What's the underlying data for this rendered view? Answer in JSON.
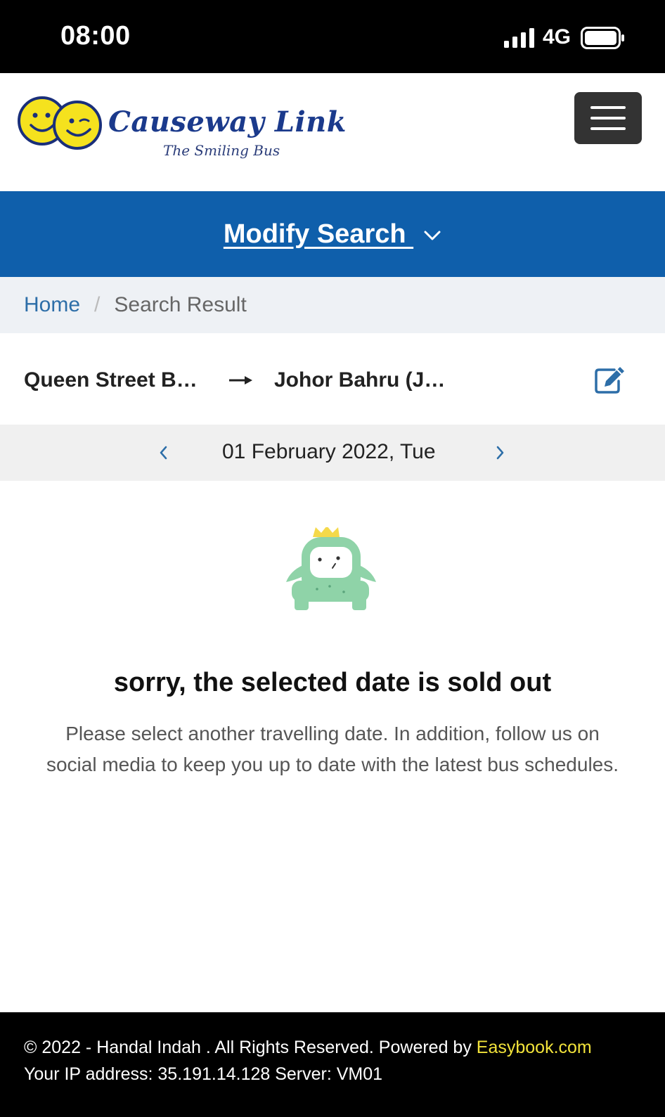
{
  "status_bar": {
    "time": "08:00",
    "network": "4G"
  },
  "header": {
    "brand_name": "Causeway Link",
    "brand_tagline": "The Smiling Bus",
    "menu_icon": "hamburger-icon"
  },
  "modify_search": {
    "label": "Modify Search ",
    "icon": "chevron-down-icon"
  },
  "breadcrumb": {
    "home": "Home",
    "separator": "/",
    "current": "Search Result"
  },
  "route": {
    "from": "Queen Street B…",
    "to": "Johor Bahru (J…",
    "arrow_icon": "arrow-right-icon",
    "edit_icon": "edit-icon"
  },
  "date_nav": {
    "date": "01 February 2022, Tue",
    "prev_icon": "chevron-left-icon",
    "next_icon": "chevron-right-icon"
  },
  "message": {
    "title": "sorry, the selected date is sold out",
    "description": "Please select another travelling date. In addition, follow us on social media to keep you up to date with the latest bus schedules."
  },
  "footer": {
    "copyright": "© 2022 - Handal Indah . All Rights Reserved. Powered by ",
    "powered_link": "Easybook.com",
    "ip_line": "Your IP address: 35.191.14.128 Server: VM01"
  },
  "colors": {
    "primary_blue": "#0f5fab",
    "link_blue": "#2d6ea8",
    "footer_link": "#f2e33a",
    "mascot_green": "#8fd3a8",
    "crown_yellow": "#f5d94a"
  }
}
